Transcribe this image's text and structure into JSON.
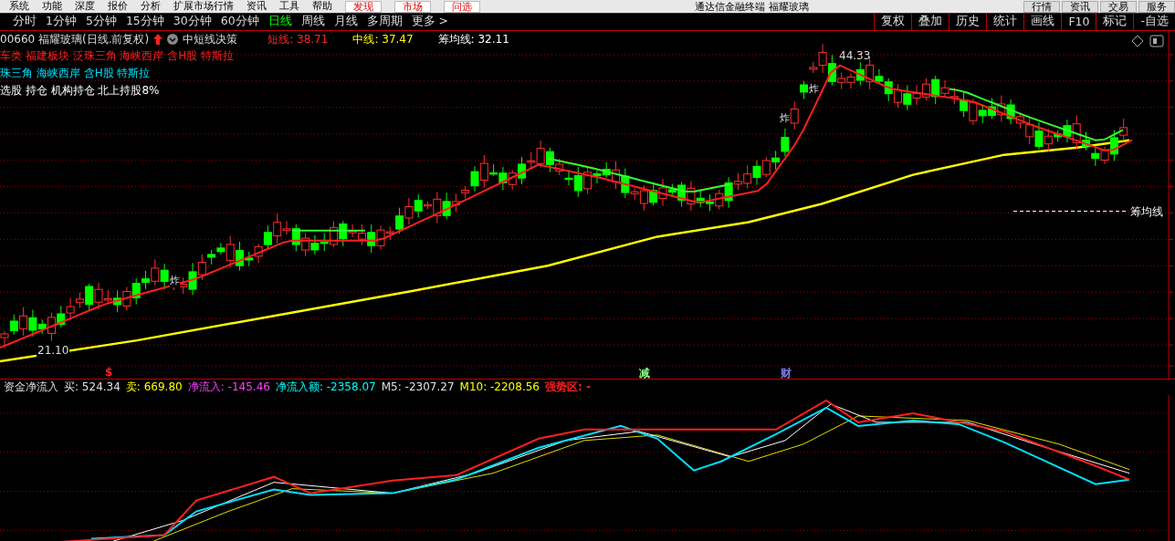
{
  "menu": [
    {
      "label": "系统",
      "highlight": false
    },
    {
      "label": "功能",
      "highlight": false
    },
    {
      "label": "深度",
      "highlight": false
    },
    {
      "label": "报价",
      "highlight": false
    },
    {
      "label": "分析",
      "highlight": false
    },
    {
      "label": "扩展市场行情",
      "highlight": false
    },
    {
      "label": "资讯",
      "highlight": false
    },
    {
      "label": "工具",
      "highlight": false
    },
    {
      "label": "帮助",
      "highlight": false
    },
    {
      "label": "发现",
      "highlight": true
    },
    {
      "label": "市场",
      "highlight": true
    },
    {
      "label": "问选",
      "highlight": true
    }
  ],
  "window_title": "通达信金融终端 福耀玻璃",
  "right_menu": [
    "行情",
    "资讯",
    "交易",
    "服务"
  ],
  "periods": [
    {
      "label": "分时",
      "selected": false
    },
    {
      "label": "1分钟",
      "selected": false
    },
    {
      "label": "5分钟",
      "selected": false
    },
    {
      "label": "15分钟",
      "selected": false
    },
    {
      "label": "30分钟",
      "selected": false
    },
    {
      "label": "60分钟",
      "selected": false
    },
    {
      "label": "日线",
      "selected": true
    },
    {
      "label": "周线",
      "selected": false
    },
    {
      "label": "月线",
      "selected": false
    },
    {
      "label": "多周期",
      "selected": false
    },
    {
      "label": "更多 >",
      "selected": false
    }
  ],
  "tools": [
    "复权",
    "叠加",
    "历史",
    "统计",
    "画线",
    "F10",
    "标记",
    "-自选"
  ],
  "stock": {
    "title": "00660 福耀玻璃(日线.前复权)",
    "indicator": "中短线决策"
  },
  "legend": [
    {
      "label": "短线: 38.71",
      "color": "#ff2a2a"
    },
    {
      "label": "中线: 37.47",
      "color": "#ffff00"
    },
    {
      "label": "筹均线: 32.11",
      "color": "#ffffff"
    }
  ],
  "tag_lines": [
    {
      "text": "车类 福建板块 泛珠三角 海峡西岸 含H股 特斯拉",
      "color": "#ff2020"
    },
    {
      "text": "珠三角 海峡西岸 含H股 特斯拉",
      "color": "#00e0ff"
    },
    {
      "text": "选股 持仓 机构持仓 北上持股8%",
      "color": "#ffffff"
    }
  ],
  "high_label": "44.33",
  "low_label": "21.10",
  "line_label": "筹均线",
  "signals": [
    "炸",
    "炸",
    "炸"
  ],
  "markers": [
    {
      "text": "$",
      "color": "#ff2020"
    },
    {
      "text": "减",
      "color": "#80ff80"
    },
    {
      "text": "财",
      "color": "#8080ff"
    }
  ],
  "indicator": {
    "name": "资金净流入",
    "values": [
      {
        "text": "买: 524.34",
        "color": "#e0e0e0"
      },
      {
        "text": "卖: 669.80",
        "color": "#ffff00"
      },
      {
        "text": "净流入: -145.46",
        "color": "#ff40ff"
      },
      {
        "text": "净流入额: -2358.07",
        "color": "#00ffff"
      },
      {
        "text": "M5: -2307.27",
        "color": "#e0e0e0"
      },
      {
        "text": "M10: -2208.56",
        "color": "#ffff00"
      },
      {
        "text": "强势区: -",
        "color": "#ff2020"
      }
    ]
  }
}
